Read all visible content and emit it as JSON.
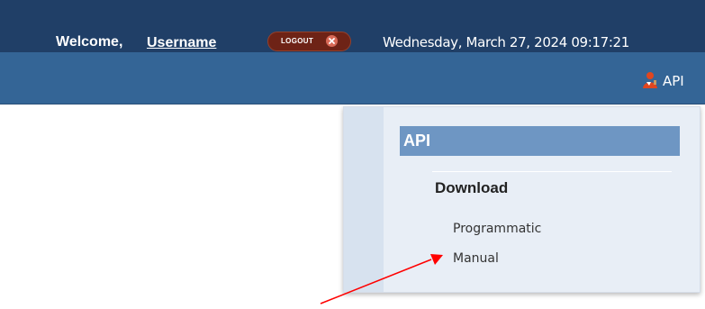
{
  "header": {
    "welcome_label": "Welcome,",
    "username": "Username",
    "logout_label": "LOGOUT",
    "logout_icon": "close-icon",
    "datetime": "Wednesday, March 27, 2024 09:17:21"
  },
  "nav": {
    "api_label": "API",
    "api_icon": "user-icon"
  },
  "menu": {
    "header": "API",
    "section": "Download",
    "items": [
      {
        "label": "Programmatic"
      },
      {
        "label": "Manual"
      }
    ]
  },
  "colors": {
    "topbar": "#203f67",
    "navbar": "#346596",
    "menu_background": "#e8eef6",
    "menu_strip": "#d7e2ef",
    "menu_header": "#6e96c3",
    "logout_button": "#6e2316",
    "annotation_arrow": "#ff0000"
  },
  "annotation": {
    "type": "arrow",
    "points_to": "Manual"
  }
}
